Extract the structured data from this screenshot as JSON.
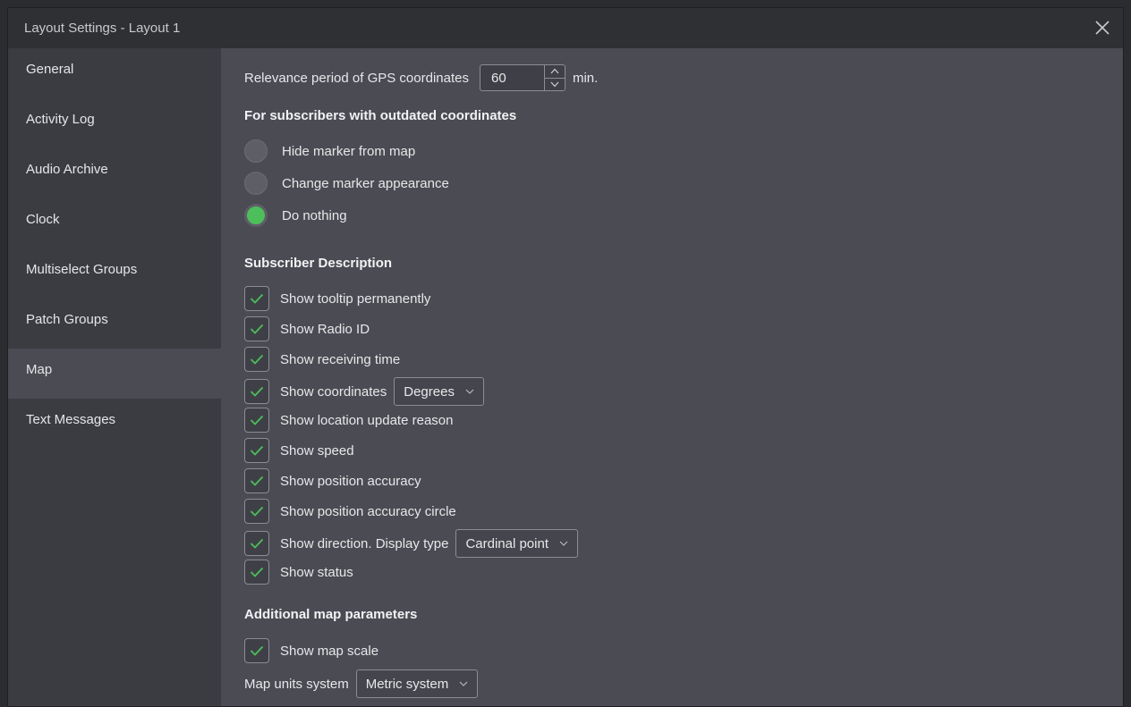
{
  "window": {
    "title": "Layout Settings - Layout 1"
  },
  "sidebar": {
    "items": [
      {
        "label": "General"
      },
      {
        "label": "Activity Log"
      },
      {
        "label": "Audio Archive"
      },
      {
        "label": "Clock"
      },
      {
        "label": "Multiselect Groups"
      },
      {
        "label": "Patch Groups"
      },
      {
        "label": "Map",
        "active": true
      },
      {
        "label": "Text Messages"
      }
    ]
  },
  "gps": {
    "label": "Relevance period of GPS coordinates",
    "value": "60",
    "unit": "min."
  },
  "outdated": {
    "heading": "For subscribers with outdated coordinates",
    "options": [
      {
        "label": "Hide marker from map",
        "selected": false
      },
      {
        "label": "Change marker appearance",
        "selected": false
      },
      {
        "label": "Do nothing",
        "selected": true
      }
    ]
  },
  "description": {
    "heading": "Subscriber Description",
    "tooltip": "Show tooltip permanently",
    "radio_id": "Show Radio ID",
    "receiving_time": "Show receiving time",
    "coordinates": "Show coordinates",
    "coordinates_format": "Degrees",
    "update_reason": "Show location update reason",
    "speed": "Show speed",
    "accuracy": "Show position accuracy",
    "accuracy_circle": "Show position accuracy circle",
    "direction": "Show direction. Display type",
    "direction_type": "Cardinal point",
    "status": "Show status"
  },
  "additional": {
    "heading": "Additional map parameters",
    "map_scale": "Show map scale",
    "units_label": "Map units system",
    "units_value": "Metric system"
  },
  "colors": {
    "accent": "#4cbe5a",
    "panel": "#4a4b53",
    "sidebar": "#3b3c42",
    "titlebar": "#2f3034"
  }
}
